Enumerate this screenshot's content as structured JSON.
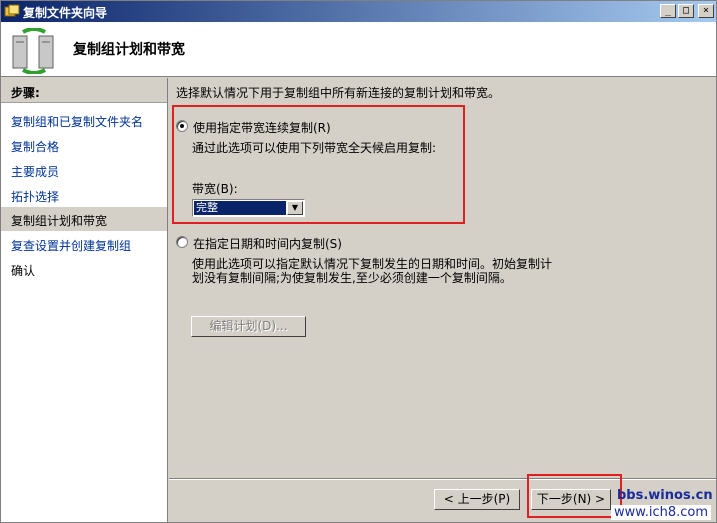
{
  "window": {
    "title": "复制文件夹向导",
    "controls": {
      "minimize": "_",
      "maximize": "□",
      "close": "×"
    }
  },
  "header": {
    "title": "复制组计划和带宽"
  },
  "sidebar": {
    "heading": "步骤:",
    "items": [
      {
        "label": "复制组和已复制文件夹名"
      },
      {
        "label": "复制合格"
      },
      {
        "label": "主要成员"
      },
      {
        "label": "拓扑选择"
      },
      {
        "label": "复制组计划和带宽"
      },
      {
        "label": "复查设置并创建复制组"
      },
      {
        "label": "确认"
      }
    ]
  },
  "main": {
    "intro": "选择默认情况下用于复制组中所有新连接的复制计划和带宽。",
    "option1": {
      "label": "使用指定带宽连续复制(R)",
      "description": "通过此选项可以使用下列带宽全天候启用复制:",
      "selected": true,
      "bandwidth_label": "带宽(B):",
      "bandwidth_value": "完整"
    },
    "option2": {
      "label": "在指定日期和时间内复制(S)",
      "description_line1": "使用此选项可以指定默认情况下复制发生的日期和时间。初始复制计",
      "description_line2": "划没有复制间隔;为使复制发生,至少必须创建一个复制间隔。",
      "selected": false,
      "edit_schedule_label": "编辑计划(D)..."
    }
  },
  "footer": {
    "back_label": "< 上一步(P)",
    "next_label": "下一步(N) >"
  },
  "watermark": {
    "main": "bbs.winos.cn",
    "sub": "www.ich8.com"
  }
}
